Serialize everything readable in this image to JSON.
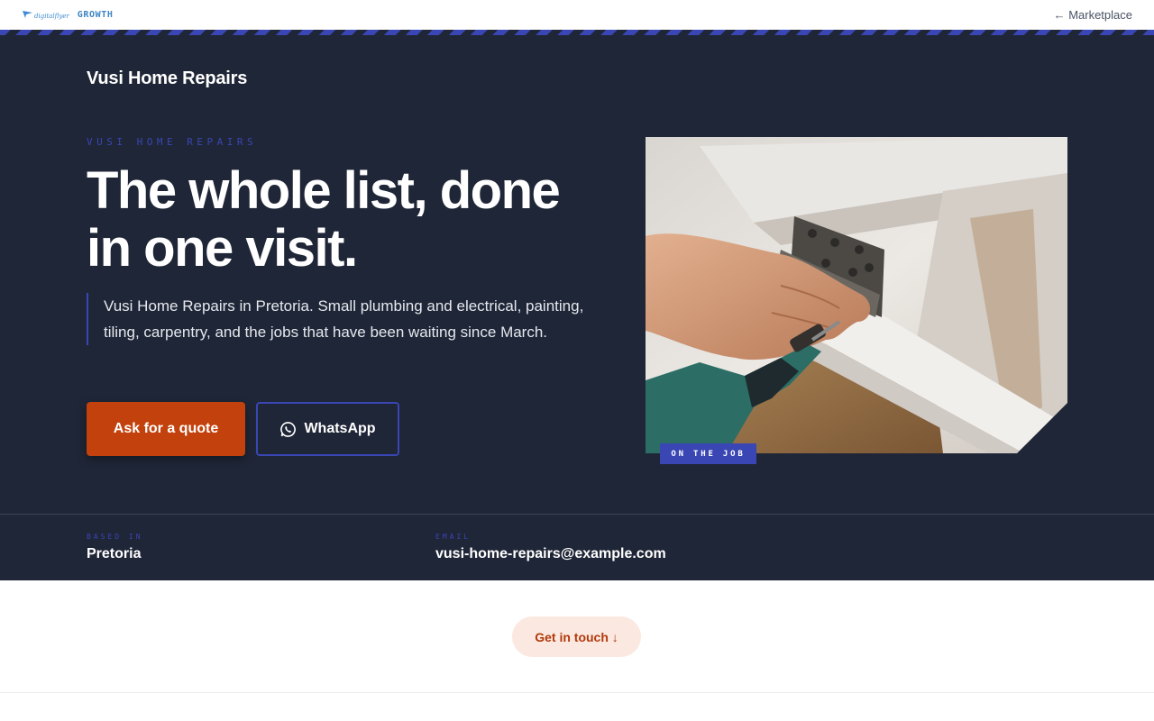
{
  "topbar": {
    "logo_text": "digitalflyer",
    "brand_label": "GROWTH",
    "back_link": "← Marketplace"
  },
  "hero": {
    "site_name": "Vusi Home Repairs",
    "eyebrow": "VUSI HOME REPAIRS",
    "headline_line1": "The whole list, done",
    "headline_line2": "in one visit.",
    "lead": "Vusi Home Repairs in Pretoria. Small plumbing and electrical, painting, tiling, carpentry, and the jobs that have been waiting since March.",
    "quote_button": "Ask for a quote",
    "whatsapp_button": "WhatsApp",
    "photo_badge": "ON THE JOB"
  },
  "info": {
    "based_label": "BASED IN",
    "based_value": "Pretoria",
    "email_label": "EMAIL",
    "email_value": "vusi-home-repairs@example.com"
  },
  "cta": {
    "touch_button": "Get in touch ↓"
  },
  "colors": {
    "hero_bg": "#1f2637",
    "accent_blue": "#3946b3",
    "accent_orange": "#c2410c",
    "cta_bg": "#fbe9e1"
  },
  "icons": {
    "back": "arrow-left-icon",
    "whatsapp": "whatsapp-icon",
    "down": "arrow-down-icon"
  }
}
